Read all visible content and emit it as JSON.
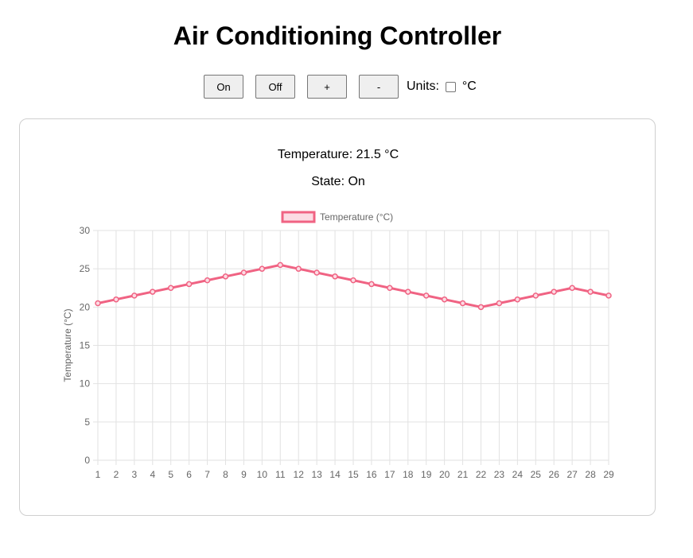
{
  "page_title": "Air Conditioning Controller",
  "controls": {
    "on_label": "On",
    "off_label": "Off",
    "increase_label": "+",
    "decrease_label": "-",
    "units_label": "Units:",
    "units_checked": false,
    "units_value": "°C"
  },
  "status": {
    "temperature_text": "Temperature: 21.5 °C",
    "state_text": "State: On"
  },
  "colors": {
    "series_line": "#f06383",
    "series_fill": "#fcdbe3",
    "grid": "#e2e2e2",
    "tick_text": "#666666"
  },
  "chart_data": {
    "type": "line",
    "title": "",
    "xlabel": "",
    "ylabel": "Temperature (°C)",
    "legend_position": "top-center",
    "grid": true,
    "ylim": [
      0,
      30
    ],
    "yticks": [
      0,
      5,
      10,
      15,
      20,
      25,
      30
    ],
    "categories": [
      "1",
      "2",
      "3",
      "4",
      "5",
      "6",
      "7",
      "8",
      "9",
      "10",
      "11",
      "12",
      "13",
      "14",
      "15",
      "16",
      "17",
      "18",
      "19",
      "20",
      "21",
      "22",
      "23",
      "24",
      "25",
      "26",
      "27",
      "28",
      "29"
    ],
    "series": [
      {
        "name": "Temperature (°C)",
        "values": [
          20.5,
          21,
          21.5,
          22,
          22.5,
          23,
          23.5,
          24,
          24.5,
          25,
          25.5,
          25,
          24.5,
          24,
          23.5,
          23,
          22.5,
          22,
          21.5,
          21,
          20.5,
          20,
          20.5,
          21,
          21.5,
          22,
          22.5,
          22,
          21.5
        ]
      }
    ]
  }
}
